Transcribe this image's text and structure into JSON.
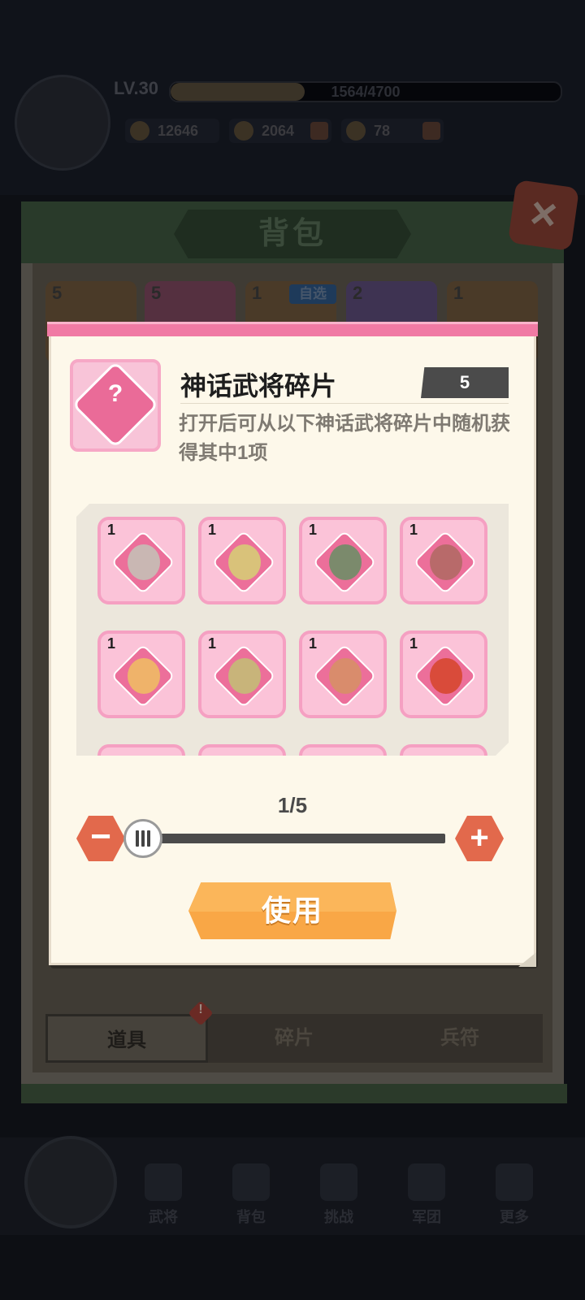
{
  "player": {
    "level": "LV.30",
    "exp_text": "1564/4700",
    "exp_fraction": 0.333,
    "power": "12646",
    "gold": "2064",
    "gems": "78"
  },
  "bag": {
    "title": "背包",
    "slot_counts": [
      "5",
      "5",
      "1",
      "2",
      "1"
    ],
    "zixuan_label": "自选",
    "tabs": [
      "道具",
      "碎片",
      "兵符"
    ],
    "active_tab": "道具",
    "tab_badge": "!"
  },
  "bottom_nav": [
    "武将",
    "背包",
    "挑战",
    "军团",
    "更多"
  ],
  "modal": {
    "item_name": "神话武将碎片",
    "item_count": "5",
    "description": "打开后可从以下神话武将碎片中随机获得其中1项",
    "fragments": [
      {
        "count": "1",
        "color": "#c9b7b3"
      },
      {
        "count": "1",
        "color": "#d9c27a"
      },
      {
        "count": "1",
        "color": "#7b8a6c"
      },
      {
        "count": "1",
        "color": "#b86a6a"
      },
      {
        "count": "1",
        "color": "#efb36a"
      },
      {
        "count": "1",
        "color": "#c8b47a"
      },
      {
        "count": "1",
        "color": "#d98c6c"
      },
      {
        "count": "1",
        "color": "#d94b3a"
      }
    ],
    "page_indicator": "1/5",
    "slider_value": 1,
    "slider_max": 5,
    "use_button": "使用",
    "minus_label": "−",
    "plus_label": "+"
  },
  "icons": {
    "close": "close-icon",
    "puzzle": "puzzle-piece-icon",
    "minus": "minus-icon",
    "plus": "plus-icon"
  }
}
